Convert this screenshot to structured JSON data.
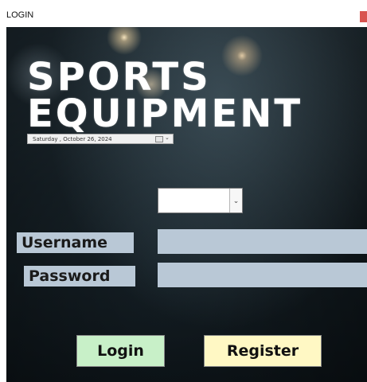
{
  "window": {
    "title": "LOGIN"
  },
  "header": {
    "line1": "SPORTS",
    "line2": "EQUIPMENT"
  },
  "date_picker": {
    "value": "Saturday  ,  October  26, 2024",
    "arrow": "⌄"
  },
  "combo": {
    "value": "",
    "arrow": "⌄"
  },
  "form": {
    "username_label": "Username",
    "username_value": "",
    "password_label": "Password",
    "password_value": ""
  },
  "buttons": {
    "login_label": "Login",
    "register_label": "Register"
  },
  "colors": {
    "field_bg": "#b9c8d6",
    "login_bg": "#c8f0c8",
    "register_bg": "#fff8c4",
    "close_button": "#d9534f"
  }
}
